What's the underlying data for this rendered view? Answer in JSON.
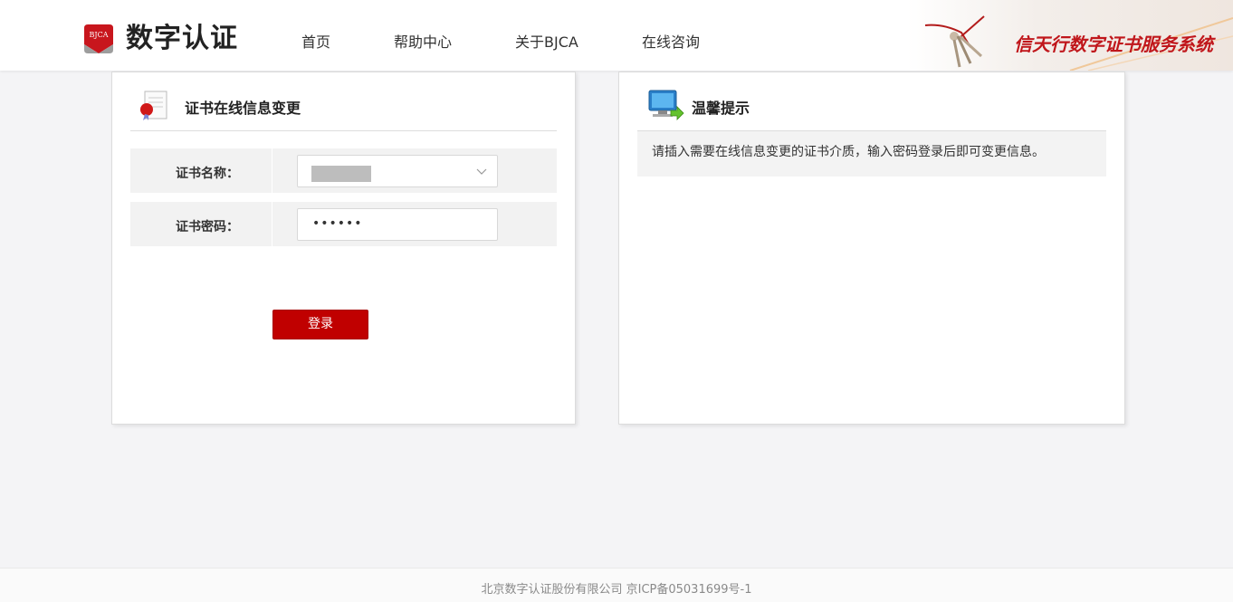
{
  "brand": {
    "badge_text": "BJCA",
    "name": "数字认证",
    "slogan": "信天行数字证书服务系统",
    "colors": {
      "brand_red": "#c0161b",
      "button_red": "#c00000"
    }
  },
  "nav": {
    "items": [
      {
        "label": "首页"
      },
      {
        "label": "帮助中心"
      },
      {
        "label": "关于BJCA"
      },
      {
        "label": "在线咨询"
      }
    ]
  },
  "left_panel": {
    "icon": "certificate-icon",
    "title": "证书在线信息变更",
    "fields": {
      "cert_name": {
        "label": "证书名称："
      },
      "cert_password": {
        "label": "证书密码：",
        "value": "••••••"
      }
    },
    "login_label": "登录"
  },
  "right_panel": {
    "icon": "computer-monitor-icon",
    "title": "温馨提示",
    "tip": "请插入需要在线信息变更的证书介质，输入密码登录后即可变更信息。"
  },
  "footer": {
    "text": "北京数字认证股份有限公司 京ICP备05031699号-1"
  }
}
